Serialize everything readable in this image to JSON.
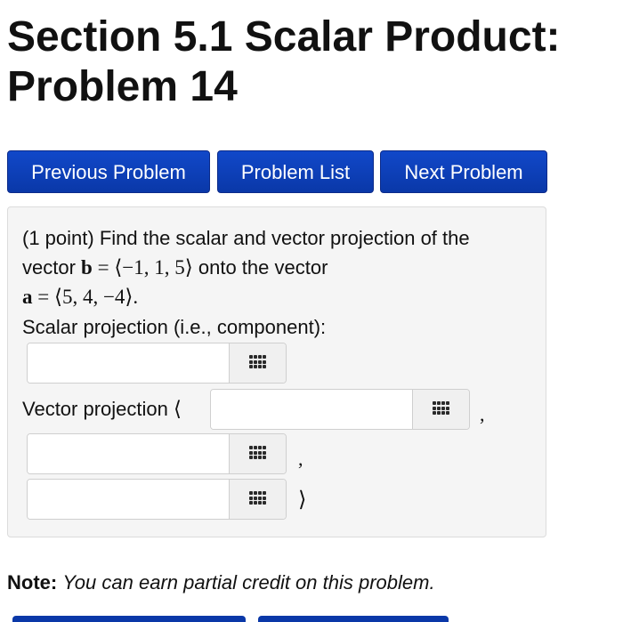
{
  "header": {
    "title_line1": "Section 5.1 Scalar Product:",
    "title_line2": "Problem 14"
  },
  "nav": {
    "previous_label": "Previous Problem",
    "list_label": "Problem List",
    "next_label": "Next Problem",
    "button_color": "#0a38a8"
  },
  "problem": {
    "intro": "(1 point) Find the scalar and vector projection of the",
    "vector_word": "vector",
    "b_symbol": "b",
    "b_value": " = ⟨−1, 1, 5⟩",
    "onto_text": "onto the vector",
    "a_symbol": "a",
    "a_value": " = ⟨5, 4, −4⟩.",
    "scalar_label": "Scalar projection (i.e., component):",
    "vector_label": "Vector projection",
    "open_bracket": "⟨",
    "close_bracket": "⟩",
    "comma": ",",
    "answers": {
      "scalar_value": "",
      "vector_x_value": "",
      "vector_y_value": "",
      "vector_z_value": ""
    },
    "palette_icon": "grid-icon"
  },
  "note": {
    "label": "Note:",
    "text": "You can earn partial credit on this problem."
  }
}
